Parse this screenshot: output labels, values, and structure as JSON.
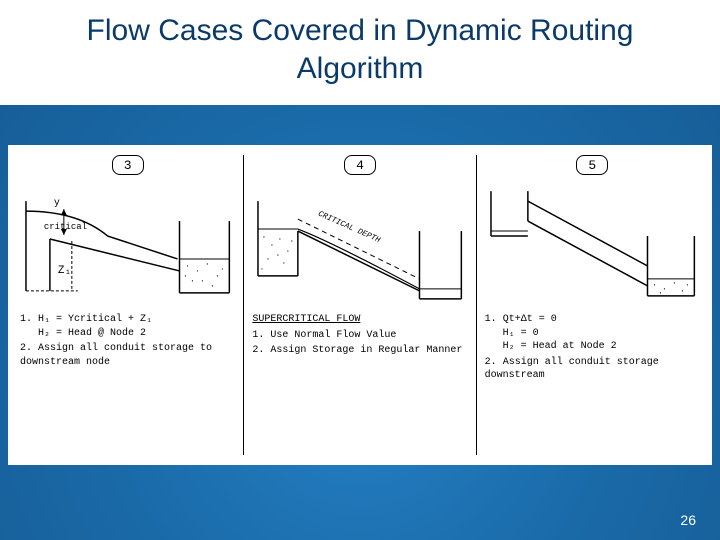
{
  "slide": {
    "title": "Flow Cases Covered in Dynamic Routing Algorithm",
    "page_number": "26"
  },
  "cases": [
    {
      "number": "3",
      "sketch_labels": {
        "y": "y",
        "critical": "critical",
        "z1": "Z₁"
      },
      "notes": {
        "heading": "",
        "items": [
          {
            "num": "1.",
            "text": "H₁ = Ycritical + Z₁",
            "sub": "H₂ = Head @ Node 2"
          },
          {
            "num": "2.",
            "text": "Assign all conduit storage to downstream node",
            "sub": ""
          }
        ]
      }
    },
    {
      "number": "4",
      "sketch_labels": {
        "critical_depth": "CRITICAL DEPTH"
      },
      "notes": {
        "heading": "SUPERCRITICAL FLOW",
        "items": [
          {
            "num": "1.",
            "text": "Use Normal Flow Value",
            "sub": ""
          },
          {
            "num": "2.",
            "text": "Assign Storage in Regular Manner",
            "sub": ""
          }
        ]
      }
    },
    {
      "number": "5",
      "sketch_labels": {},
      "notes": {
        "heading": "",
        "items": [
          {
            "num": "1.",
            "text": "Qt+Δt = 0",
            "sub": "H₁ = 0\nH₂ = Head at Node 2"
          },
          {
            "num": "2.",
            "text": "Assign all conduit storage downstream",
            "sub": ""
          }
        ]
      }
    }
  ]
}
